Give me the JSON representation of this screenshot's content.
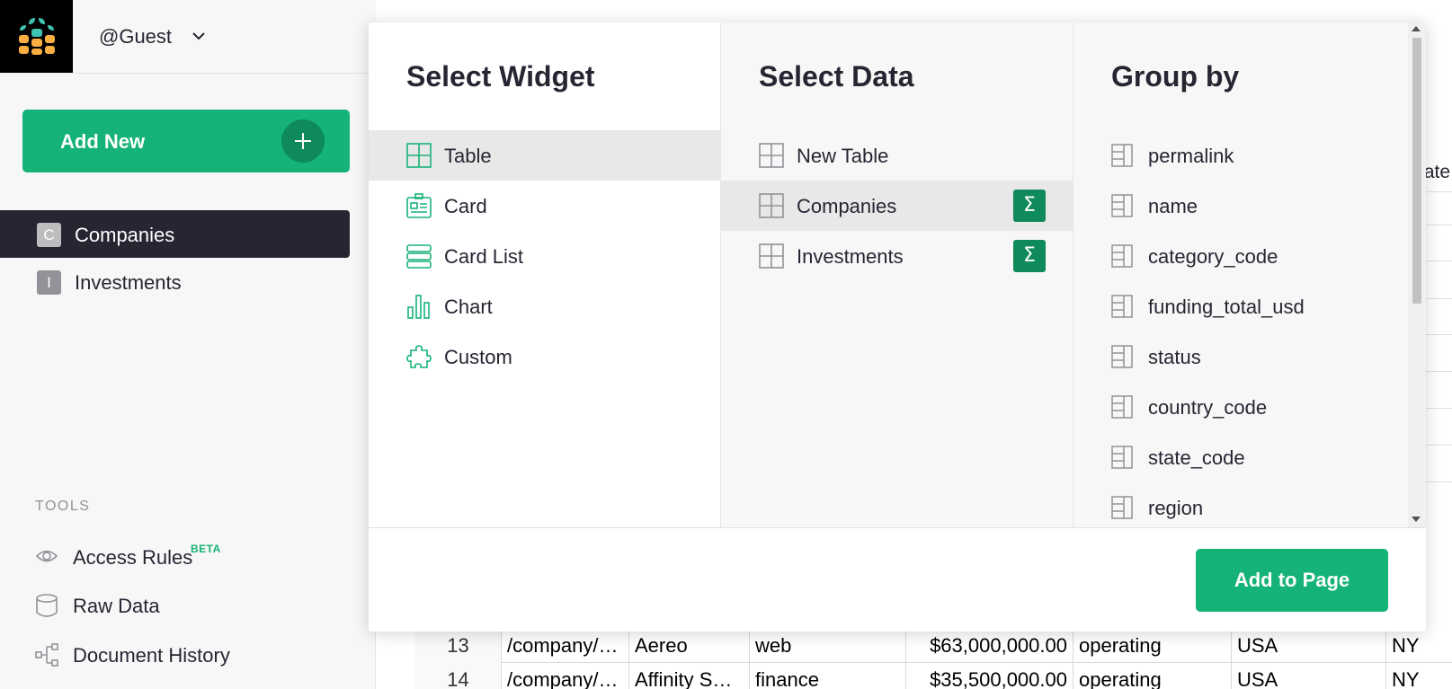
{
  "account": {
    "name": "@Guest"
  },
  "sidebar": {
    "add_new_label": "Add New",
    "pages": [
      {
        "badge": "C",
        "label": "Companies",
        "active": true
      },
      {
        "badge": "I",
        "label": "Investments",
        "active": false
      }
    ],
    "tools_header": "TOOLS",
    "tools": [
      {
        "label": "Access Rules",
        "badge": "BETA",
        "icon": "eye-icon"
      },
      {
        "label": "Raw Data",
        "icon": "database-icon"
      },
      {
        "label": "Document History",
        "icon": "history-icon"
      }
    ]
  },
  "dialog": {
    "widget": {
      "title": "Select Widget",
      "options": [
        {
          "label": "Table",
          "icon": "table-icon",
          "selected": true
        },
        {
          "label": "Card",
          "icon": "card-icon"
        },
        {
          "label": "Card List",
          "icon": "card-list-icon"
        },
        {
          "label": "Chart",
          "icon": "chart-icon"
        },
        {
          "label": "Custom",
          "icon": "puzzle-icon"
        }
      ]
    },
    "data": {
      "title": "Select Data",
      "options": [
        {
          "label": "New Table",
          "icon": "table-icon"
        },
        {
          "label": "Companies",
          "icon": "table-icon",
          "selected": true,
          "sigma": "Σ"
        },
        {
          "label": "Investments",
          "icon": "table-icon",
          "sigma": "Σ"
        }
      ]
    },
    "group": {
      "title": "Group by",
      "fields": [
        "permalink",
        "name",
        "category_code",
        "funding_total_usd",
        "status",
        "country_code",
        "state_code",
        "region"
      ]
    },
    "add_button": "Add to Page"
  },
  "background_grid": {
    "header_fragment": "tate",
    "rows": [
      {
        "row": "13",
        "permalink": "/company/…",
        "name": "Aereo",
        "category": "web",
        "funding": "$63,000,000.00",
        "status": "operating",
        "country": "USA",
        "state": "NY"
      },
      {
        "row": "14",
        "permalink": "/company/…",
        "name": "Affinity S…",
        "category": "finance",
        "funding": "$35,500,000.00",
        "status": "operating",
        "country": "USA",
        "state": "NY"
      }
    ]
  },
  "colors": {
    "accent": "#16b378",
    "accent_dark": "#0f8a5a",
    "active_bg": "#262633"
  }
}
